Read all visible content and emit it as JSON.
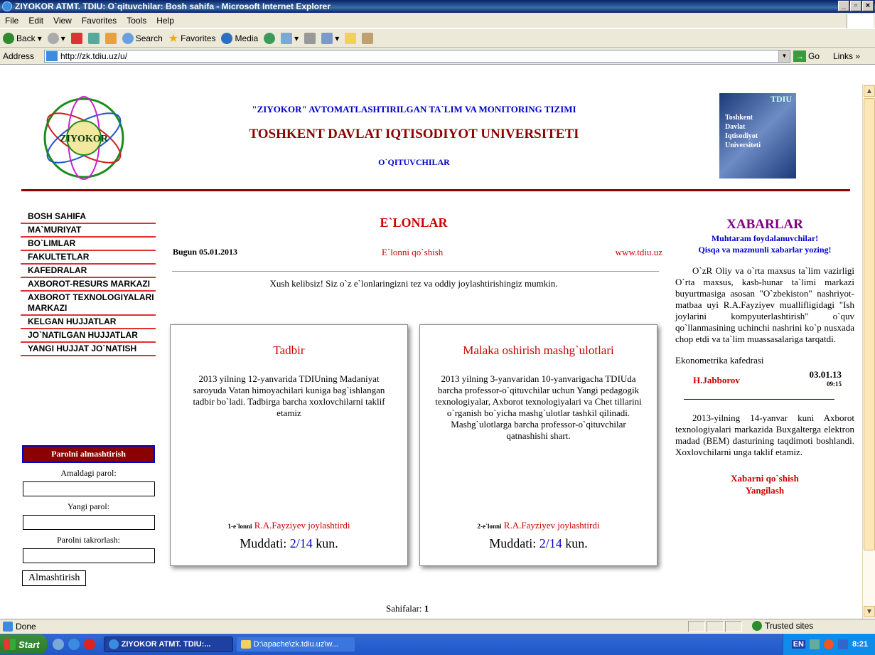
{
  "window": {
    "title": "ZIYOKOR ATMT. TDIU: O`qituvchilar: Bosh sahifa - Microsoft Internet Explorer"
  },
  "menu": [
    "File",
    "Edit",
    "View",
    "Favorites",
    "Tools",
    "Help"
  ],
  "toolbar": {
    "back": "Back",
    "search": "Search",
    "favorites": "Favorites",
    "media": "Media"
  },
  "address": {
    "label": "Address",
    "url": "http://zk.tdiu.uz/u/",
    "go": "Go",
    "links": "Links »"
  },
  "header": {
    "logo_text": "ZIYOKOR",
    "line1": "\"ZIYOKOR\" AVTOMATLASHTIRILGAN  TA`LIM VA MONITORING TIZIMI",
    "line2": "TOSHKENT DAVLAT IQTISODIYOT UNIVERSITETI",
    "line3": "O`QITUVCHILAR",
    "right_logo_top": "TDIU",
    "right_logo": [
      "Toshkent",
      "Davlat",
      "Iqtisodiyot",
      "Universiteti"
    ]
  },
  "nav": [
    "BOSH SAHIFA",
    "MA`MURIYAT",
    "BO`LIMLAR",
    "FAKULTETLAR",
    "KAFEDRALAR",
    "AXBOROT-RESURS MARKAZI",
    "AXBOROT TEXNOLOGIYALARI MARKAZI",
    "KELGAN HUJJATLAR",
    "JO`NATILGAN HUJJATLAR",
    "YANGI HUJJAT JO`NATISH"
  ],
  "password": {
    "header": "Parolni almashtirish",
    "current_label": "Amaldagi parol:",
    "new_label": "Yangi parol:",
    "repeat_label": "Parolni takrorlash:",
    "button": "Almashtirish"
  },
  "center": {
    "title": "E`LONLAR",
    "today": "Bugun 05.01.2013",
    "add_link": "E`lonni qo`shish",
    "site_link": "www.tdiu.uz",
    "welcome": "Xush kelibsiz! Siz o`z e`lonlaringizni tez va oddiy joylashtirishingiz mumkin."
  },
  "cards": [
    {
      "title": "Tadbir",
      "body": "2013 yilning 12-yanvarida TDIUning Madaniyat saroyuda Vatan himoyachilari kuniga bag`ishlangan tadbir bo`ladi. Tadbirga barcha xoxlovchilarni taklif etamiz",
      "num": "1-e`lonni",
      "author": "R.A.Fayziyev joylashtirdi",
      "term_label": "Muddati:",
      "term_value": "2/14",
      "term_unit": "kun."
    },
    {
      "title": "Malaka oshirish mashg`ulotlari",
      "body": "2013 yilning 3-yanvaridan 10-yanvarigacha TDIUda barcha professor-o`qituvchilar uchun Yangi pedagogik texnologiyalar, Axborot texnologiyalari va Chet tillarini o`rganish bo`yicha mashg`ulotlar tashkil qilinadi. Mashg`ulotlarga barcha professor-o`qituvchilar qatnashishi shart.",
      "num": "2-e`lonni",
      "author": "R.A.Fayziyev joylashtirdi",
      "term_label": "Muddati:",
      "term_value": "2/14",
      "term_unit": "kun."
    }
  ],
  "news": {
    "title": "XABARLAR",
    "sub1": "Muhtaram foydalanuvchilar!",
    "sub2": "Qisqa va mazmunli xabarlar yozing!",
    "item1": "O`zR Oliy va o`rta maxsus ta`lim vazirligi O`rta maxsus, kasb-hunar ta`limi markazi buyurtmasiga asosan \"O`zbekiston\" nashriyot-matbaa uyi R.A.Fayziyev muallifligidagi \"Ish joylarini kompyuterlashtirish\" o`quv qo`llanmasining uchinchi nashrini ko`p nusxada chop etdi va ta`lim muassasalariga tarqatdi.",
    "dept": "Ekonometrika kafedrasi",
    "author": "H.Jabborov",
    "date": "03.01.13",
    "time": "09:15",
    "item2": "2013-yilning 14-yanvar kuni Axborot texnologiyalari markazida Buxgalterga elektron madad (BEM) dasturining taqdimoti boshlandi. Xoxlovchilarni unga taklif etamiz.",
    "add": "Xabarni qo`shish",
    "refresh": "Yangilash"
  },
  "pages": {
    "label": "Sahifalar:",
    "value": "1"
  },
  "status": {
    "left": "Done",
    "zone": "Trusted sites"
  },
  "taskbar": {
    "start": "Start",
    "task1": "ZIYOKOR ATMT. TDIU:...",
    "task2": "D:\\apache\\zk.tdiu.uz\\w...",
    "lang": "EN",
    "clock": "8:21"
  }
}
